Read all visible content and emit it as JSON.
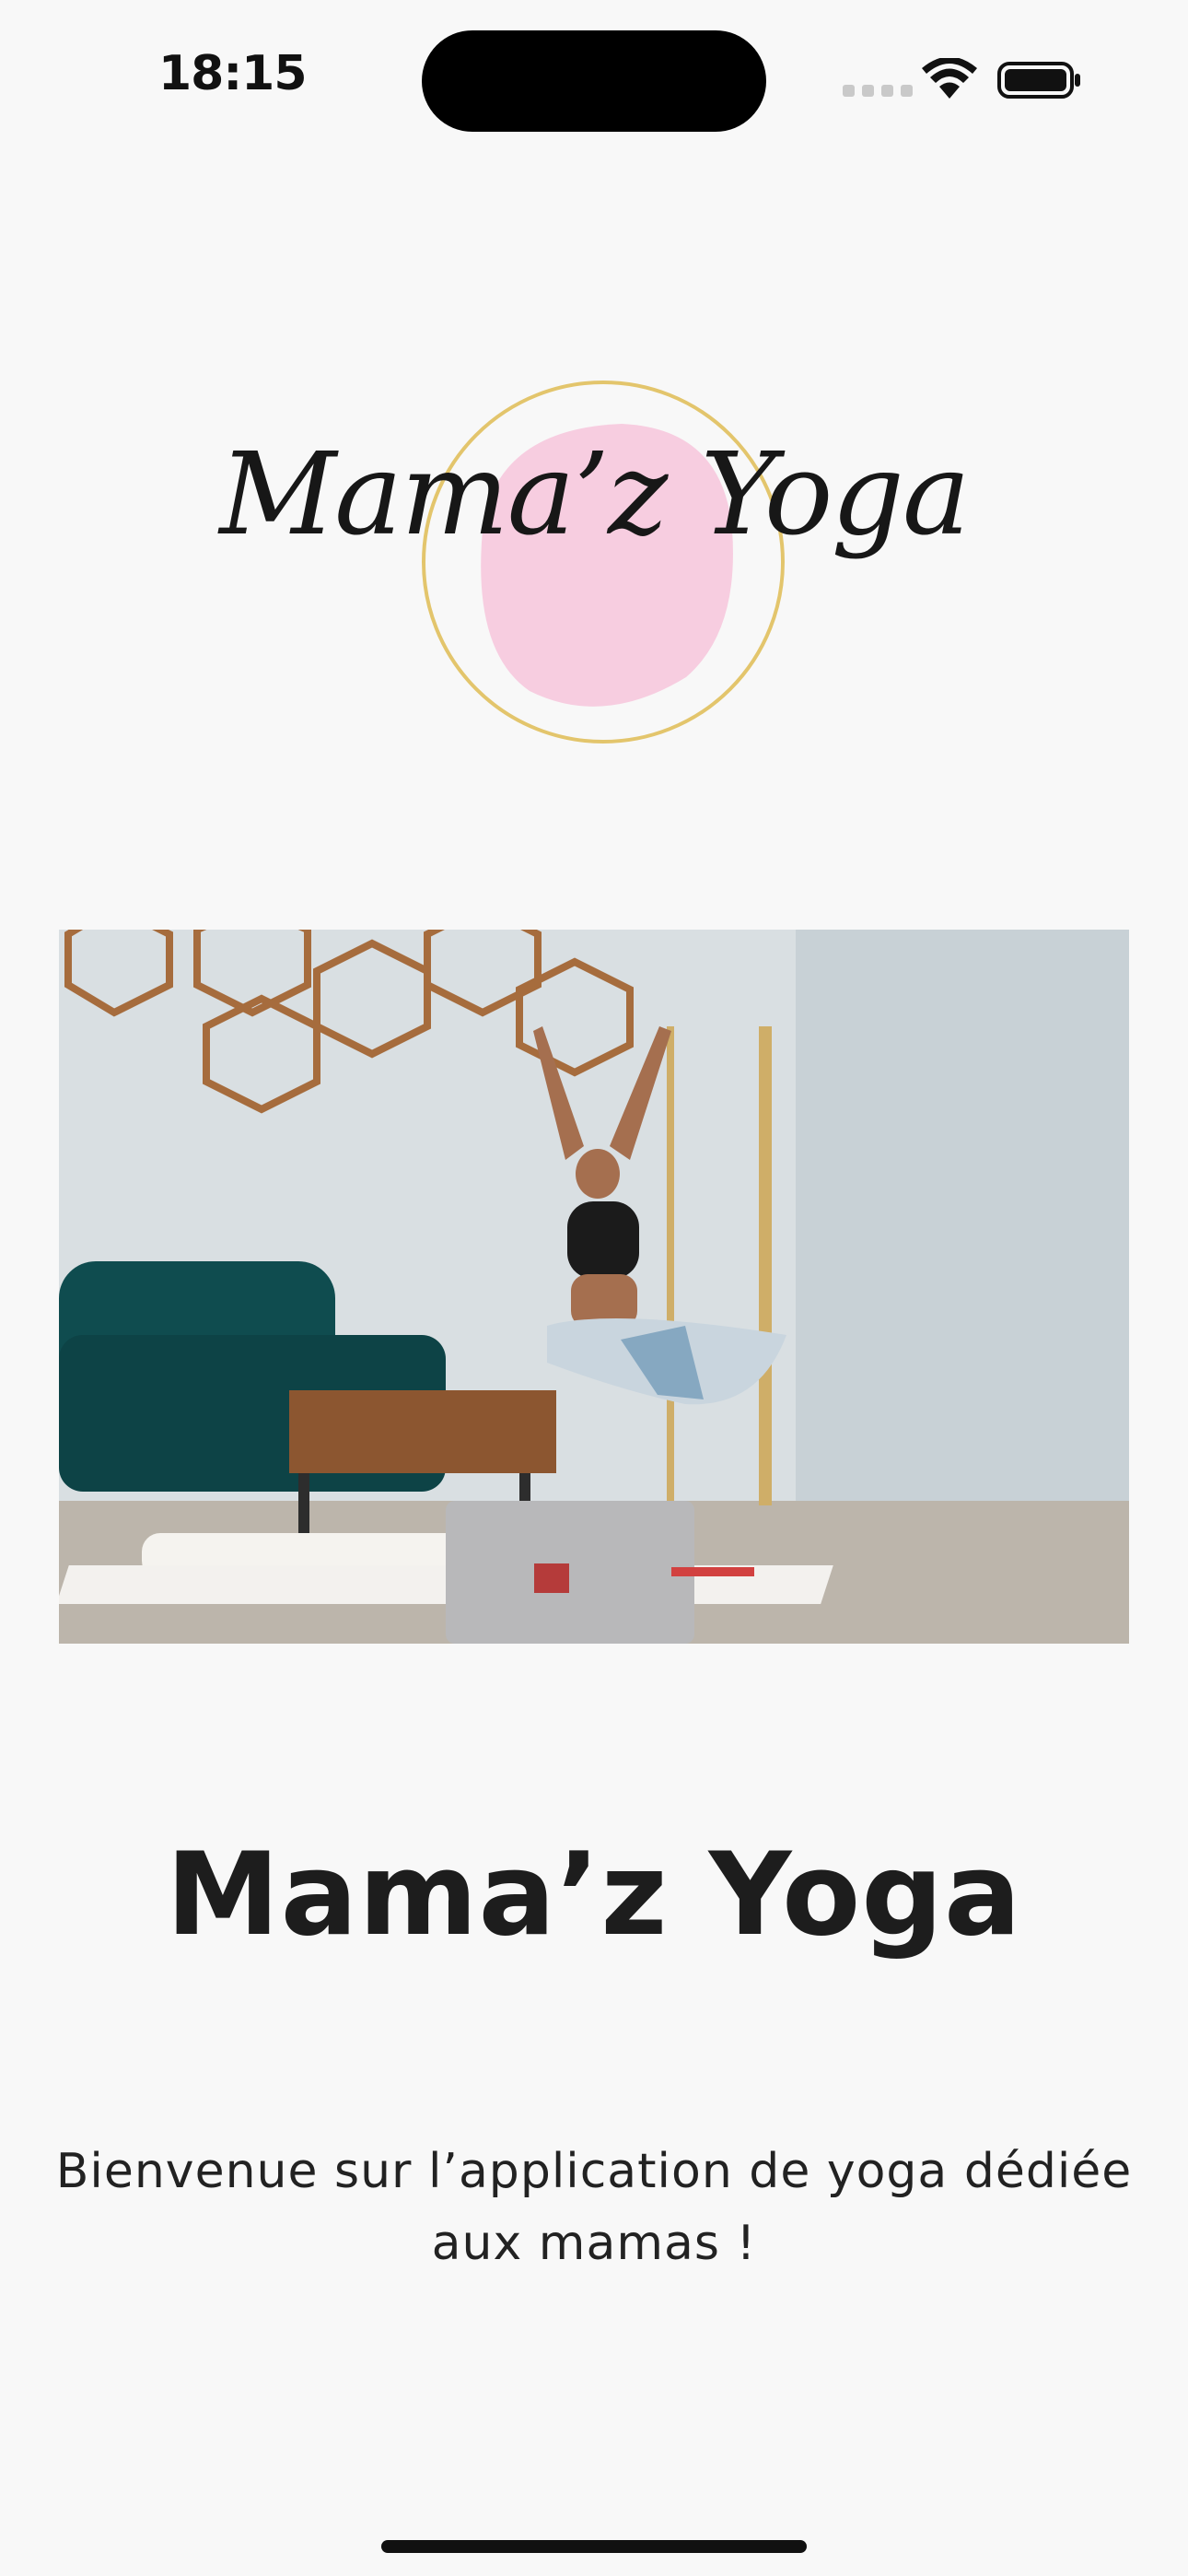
{
  "status_bar": {
    "time": "18:15",
    "icons": [
      "cellular-icon",
      "wifi-icon",
      "battery-icon"
    ]
  },
  "logo": {
    "text": "Mama’z Yoga",
    "circle_color": "#f7cde0",
    "ring_color": "#e3c56c"
  },
  "hero_image": {
    "alt": "Mama’z Yoga"
  },
  "main": {
    "title": "Mama’z Yoga",
    "welcome_text": "Bienvenue sur l’application de yoga dédiée aux mamas !"
  },
  "colors": {
    "background": "#f8f8f8",
    "text": "#1d1d1d"
  }
}
